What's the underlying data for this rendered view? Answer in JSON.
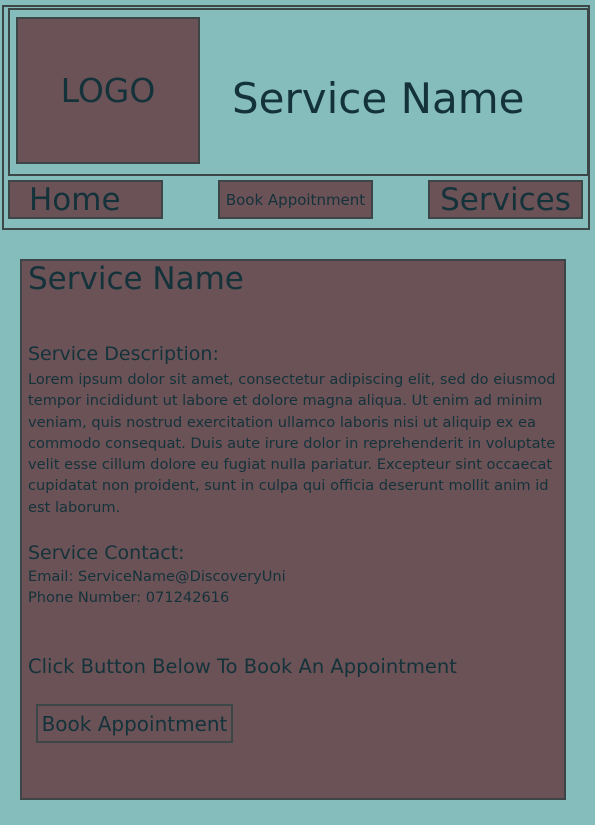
{
  "header": {
    "logo_text": "LOGO",
    "site_title": "Service Name"
  },
  "nav": {
    "home": "Home",
    "book": "Book Appoitnment",
    "services": "Services"
  },
  "content": {
    "title": "Service Name",
    "description_heading": "Service Description:",
    "description_text": "Lorem ipsum dolor sit amet, consectetur adipiscing elit, sed do eiusmod tempor incididunt ut labore et dolore magna aliqua. Ut enim ad minim veniam, quis nostrud exercitation ullamco laboris nisi ut aliquip ex ea commodo consequat. Duis aute irure dolor in reprehenderit in voluptate velit esse cillum dolore eu fugiat nulla pariatur. Excepteur sint occaecat cupidatat non proident, sunt in culpa qui officia deserunt mollit anim id est laborum.",
    "contact_heading": "Service Contact:",
    "email": "Email: ServiceName@DiscoveryUni",
    "phone": "Phone Number: 071242616",
    "cta_text": "Click Button Below To Book An Appointment",
    "book_button": "Book Appointment"
  },
  "colors": {
    "background": "#85bcbc",
    "panel": "#6b5257",
    "border": "#3c4646",
    "text": "#14323a"
  }
}
